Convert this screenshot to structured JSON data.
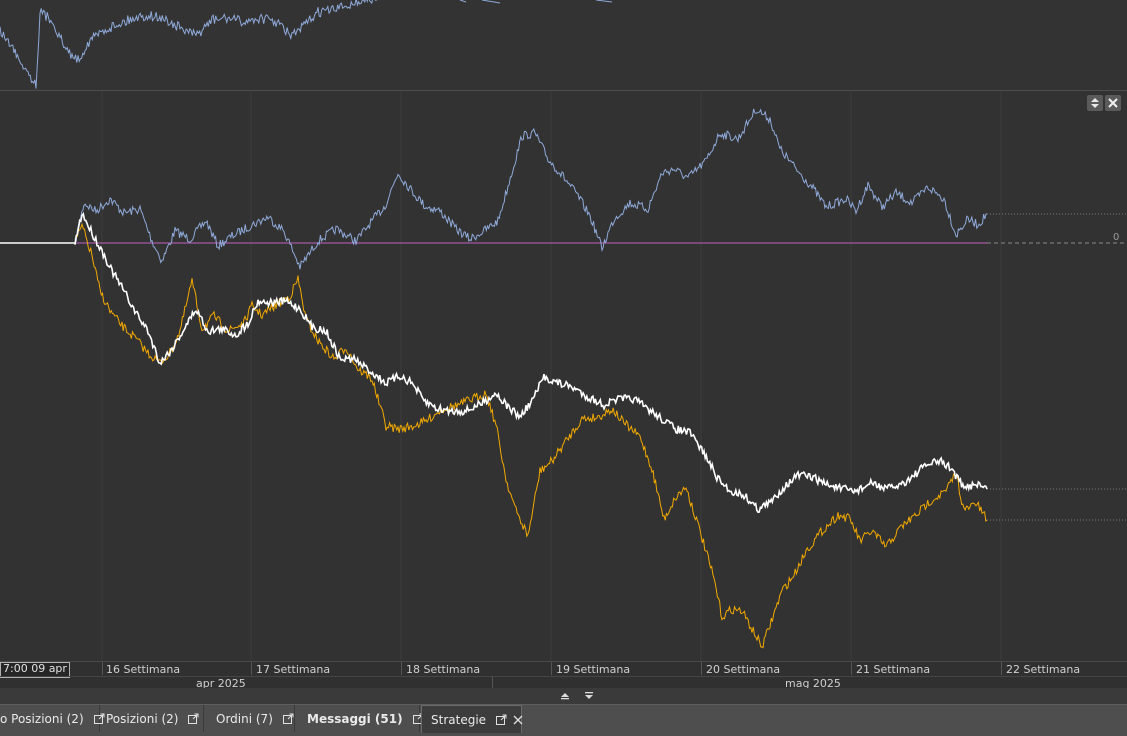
{
  "time_axis": {
    "cursor_date": "7:00 09 apr",
    "weeks": [
      "16 Settimana",
      "17 Settimana",
      "18 Settimana",
      "19 Settimana",
      "20 Settimana",
      "21 Settimana",
      "22 Settimana"
    ],
    "months": [
      "apr 2025",
      "mag 2025"
    ]
  },
  "price_scale": {
    "zero_label": "0"
  },
  "tabs": [
    {
      "label": "o Posizioni (2)",
      "bold": false,
      "active": false
    },
    {
      "label": "Posizioni (2)",
      "bold": false,
      "active": false
    },
    {
      "label": "Ordini (7)",
      "bold": false,
      "active": false
    },
    {
      "label": "Messaggi (51)",
      "bold": true,
      "active": false
    },
    {
      "label": "Strategie",
      "bold": false,
      "active": true
    }
  ],
  "colors": {
    "background": "#323232",
    "blue_series": "#8fa9d8",
    "white_series": "#ffffff",
    "orange_series": "#f2a900",
    "zero_line": "#c060c0",
    "tab_bar": "#4e4e4e"
  },
  "icons": {
    "pane_resize": "up-down-arrows-icon",
    "pane_close": "close-icon",
    "expand_up": "arrow-up-icon",
    "expand_down": "arrow-down-icon",
    "tab_popout": "popout-icon",
    "tab_close": "close-icon"
  }
}
